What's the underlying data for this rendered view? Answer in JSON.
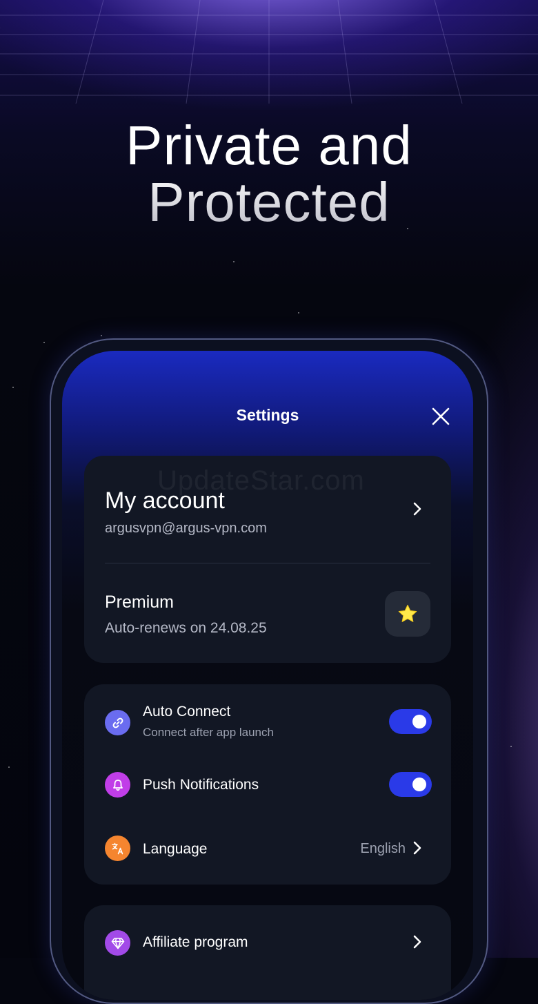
{
  "headline": {
    "line1": "Private and",
    "line2": "Protected"
  },
  "settings": {
    "title": "Settings",
    "watermark": "UpdateStar.com",
    "account": {
      "title": "My account",
      "email": "argusvpn@argus-vpn.com"
    },
    "premium": {
      "title": "Premium",
      "subtitle": "Auto-renews on 24.08.25"
    },
    "rows": [
      {
        "label": "Auto Connect",
        "sub": "Connect after app launch",
        "enabled": true,
        "icon": "link-icon"
      },
      {
        "label": "Push Notifications",
        "enabled": true,
        "icon": "bell-icon"
      },
      {
        "label": "Language",
        "value": "English",
        "icon": "translate-icon"
      }
    ],
    "affiliate": {
      "label": "Affiliate program",
      "icon": "diamond-icon"
    }
  },
  "colors": {
    "accent": "#2a3ae8",
    "star": "#ffe94a",
    "link_icon_bg": "#6a6cf0",
    "bell_icon_bg": "#c13ee8",
    "translate_icon_bg": "#f5852f",
    "diamond_icon_bg": "#a24ae8"
  }
}
